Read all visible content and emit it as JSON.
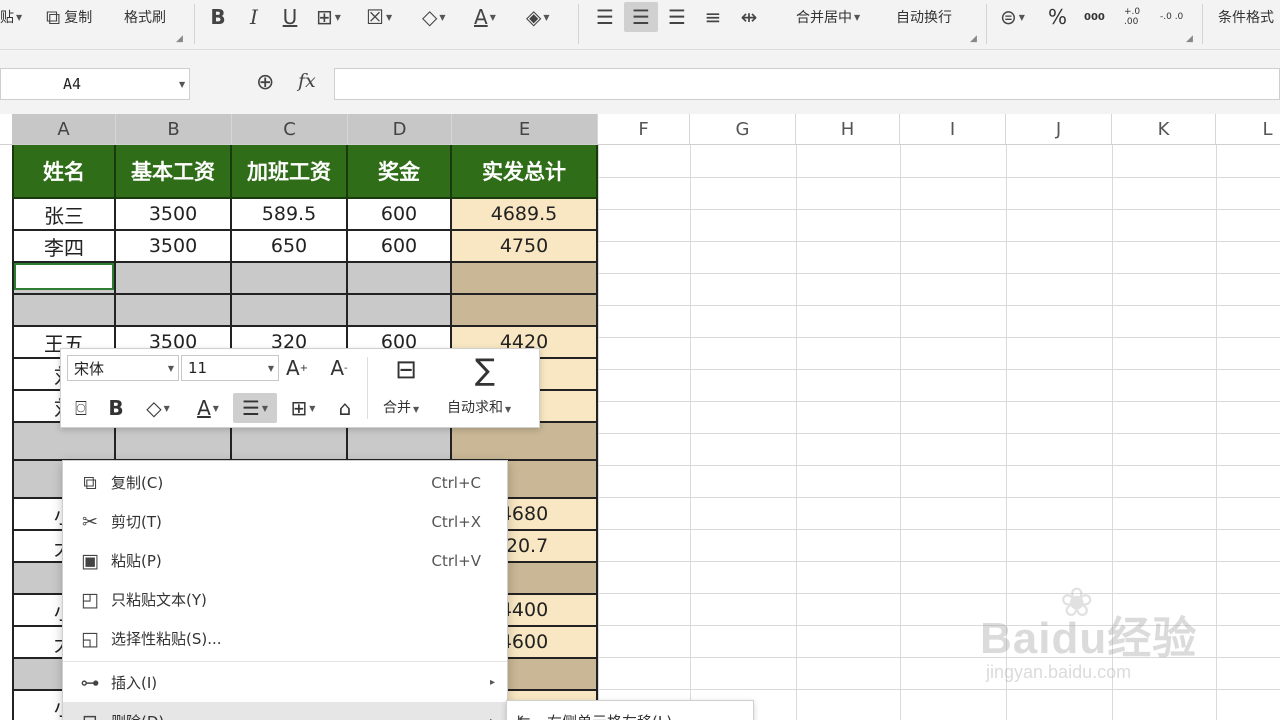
{
  "ribbon": {
    "paste_label": "贴",
    "copy_label": "复制",
    "format_painter_label": "格式刷",
    "merge_center_label": "合并居中",
    "wrap_text_label": "自动换行",
    "percent_label": "%",
    "thousands_label": "000",
    "inc_decimal_label": "+.0 .00",
    "dec_decimal_label": "-.0 .0",
    "conditional_label": "条件格式",
    "icons": [
      "bold-icon",
      "italic-icon",
      "underline-icon",
      "border-icon",
      "cell-style-icon",
      "fill-color-icon",
      "font-color-icon",
      "clear-icon",
      "align-left-icon",
      "align-center-icon",
      "align-right-icon",
      "justify-icon",
      "distributed-icon",
      "currency-icon"
    ]
  },
  "formula_bar": {
    "name_box": "A4",
    "fx_label": "fx",
    "formula": ""
  },
  "columns": [
    "A",
    "B",
    "C",
    "D",
    "E",
    "F",
    "G",
    "H",
    "I",
    "J",
    "K",
    "L"
  ],
  "table": {
    "headers": [
      "姓名",
      "基本工资",
      "加班工资",
      "奖金",
      "实发总计"
    ],
    "rows": [
      [
        "张三",
        "3500",
        "589.5",
        "600",
        "4689.5"
      ],
      [
        "李四",
        "3500",
        "650",
        "600",
        "4750"
      ],
      [
        "",
        "",
        "",
        "",
        ""
      ],
      [
        "",
        "",
        "",
        "",
        ""
      ],
      [
        "王五",
        "3500",
        "320",
        "600",
        "4420"
      ],
      [
        "刘",
        "",
        "",
        "",
        ".5"
      ],
      [
        "刘",
        "",
        "",
        "",
        ".3"
      ],
      [
        "",
        "",
        "",
        "",
        ""
      ],
      [
        "",
        "",
        "",
        "",
        ""
      ],
      [
        "小",
        "",
        "",
        "",
        "4680"
      ],
      [
        "大",
        "",
        "",
        "",
        ".20.7"
      ],
      [
        "",
        "",
        "",
        "",
        ""
      ],
      [
        "小",
        "",
        "",
        "",
        "4400"
      ],
      [
        "大",
        "",
        "",
        "",
        "4600"
      ],
      [
        "",
        "",
        "",
        "",
        ""
      ],
      [
        "小",
        "",
        "",
        "",
        ""
      ]
    ]
  },
  "mini_toolbar": {
    "font_name": "宋体",
    "font_size": "11",
    "grow_font": "A",
    "shrink_font": "A",
    "bold": "B",
    "merge_label": "合并",
    "autosum_label": "自动求和"
  },
  "context_menu": {
    "items": [
      {
        "label": "复制(C)",
        "shortcut": "Ctrl+C",
        "icon": "copy-icon"
      },
      {
        "label": "剪切(T)",
        "shortcut": "Ctrl+X",
        "icon": "cut-icon"
      },
      {
        "label": "粘贴(P)",
        "shortcut": "Ctrl+V",
        "icon": "paste-icon"
      },
      {
        "label": "只粘贴文本(Y)",
        "shortcut": "",
        "icon": "paste-text-icon"
      },
      {
        "label": "选择性粘贴(S)...",
        "shortcut": "",
        "icon": "paste-special-icon"
      },
      {
        "label": "插入(I)",
        "shortcut": "",
        "icon": "insert-icon"
      },
      {
        "label": "删除(D)",
        "shortcut": "",
        "icon": "delete-icon"
      }
    ],
    "submenu_label": "右侧单元格左移(L)"
  },
  "watermark": {
    "brand": "Baidu经验",
    "url": "jingyan.baidu.com"
  },
  "colors": {
    "header_fill": "#2f6d18",
    "total_fill": "#f8e7c2",
    "blank_fill": "#c9c9c9",
    "ribbon_bg": "#f3f3f3"
  }
}
